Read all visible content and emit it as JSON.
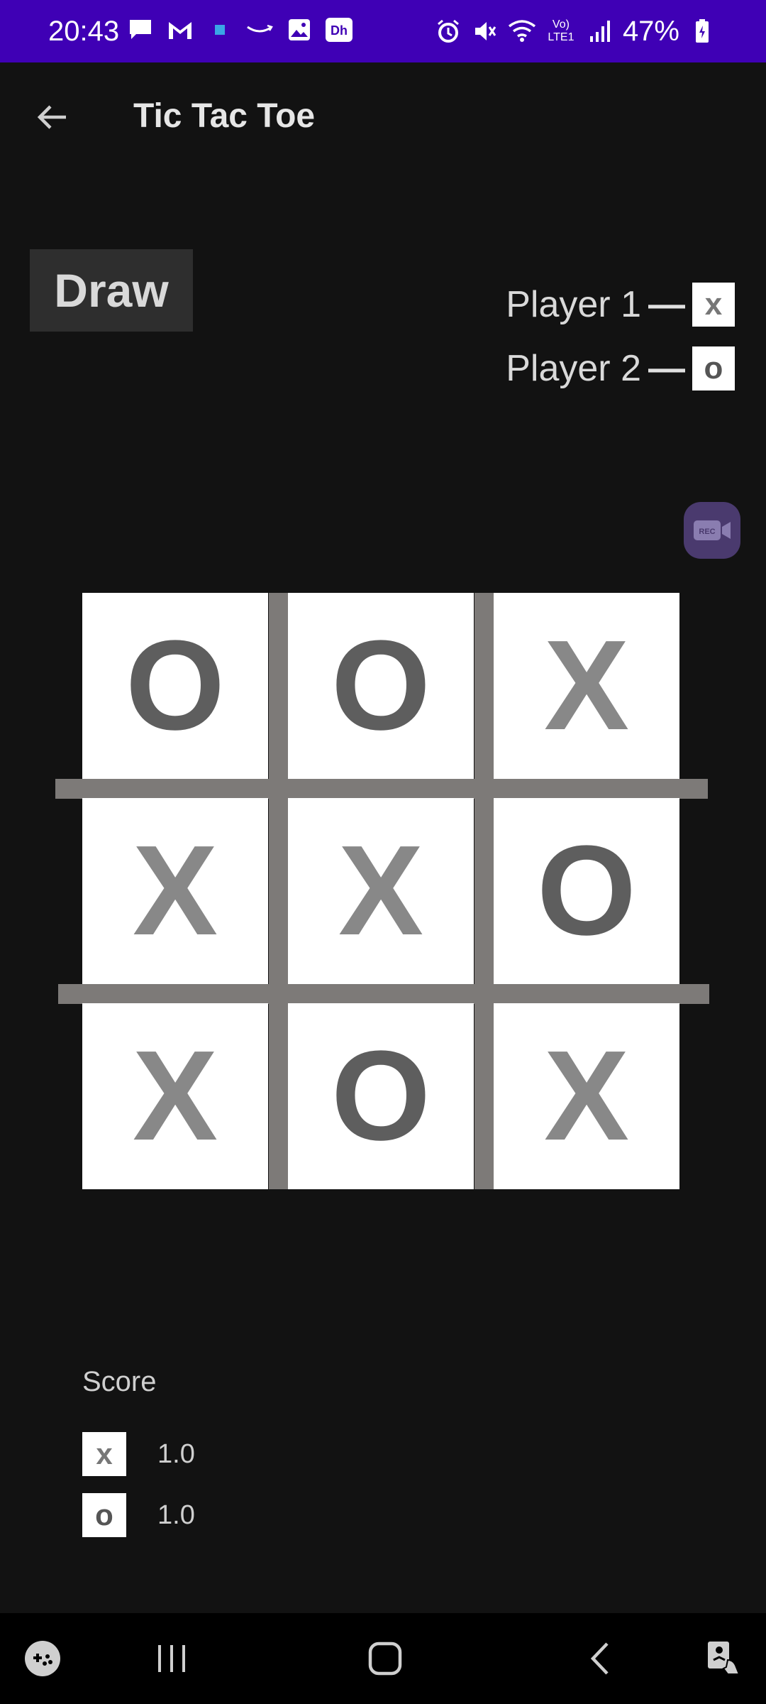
{
  "status_bar": {
    "time": "20:43",
    "battery": "47%",
    "network_label": "Vo) LTE1",
    "icons_left": [
      "chat-icon",
      "gmail-icon",
      "app-icon",
      "amazon-icon",
      "gallery-icon",
      "hotstar-icon"
    ],
    "icons_right": [
      "alarm-icon",
      "mute-icon",
      "wifi-icon",
      "signal-icon",
      "battery-icon"
    ]
  },
  "app_bar": {
    "title": "Tic Tac Toe",
    "back_icon": "arrow-left-icon"
  },
  "result": "Draw",
  "players": [
    {
      "label": "Player 1",
      "dash": "—",
      "mark": "x"
    },
    {
      "label": "Player 2",
      "dash": "—",
      "mark": "o"
    }
  ],
  "rec_button": {
    "label": "REC"
  },
  "board": {
    "cells": [
      "O",
      "O",
      "X",
      "X",
      "X",
      "O",
      "X",
      "O",
      "X"
    ]
  },
  "score": {
    "title": "Score",
    "rows": [
      {
        "mark": "x",
        "value": "1.0"
      },
      {
        "mark": "o",
        "value": "1.0"
      }
    ]
  },
  "nav_bar": {
    "items": [
      "game-launcher-icon",
      "recents-icon",
      "home-icon",
      "back-icon",
      "accessibility-icon"
    ]
  },
  "colors": {
    "status_bar": "#3f00b5",
    "background": "#121212",
    "grid": "#7d7a78",
    "x_mark": "#888888",
    "o_mark": "#5e5e5e"
  }
}
